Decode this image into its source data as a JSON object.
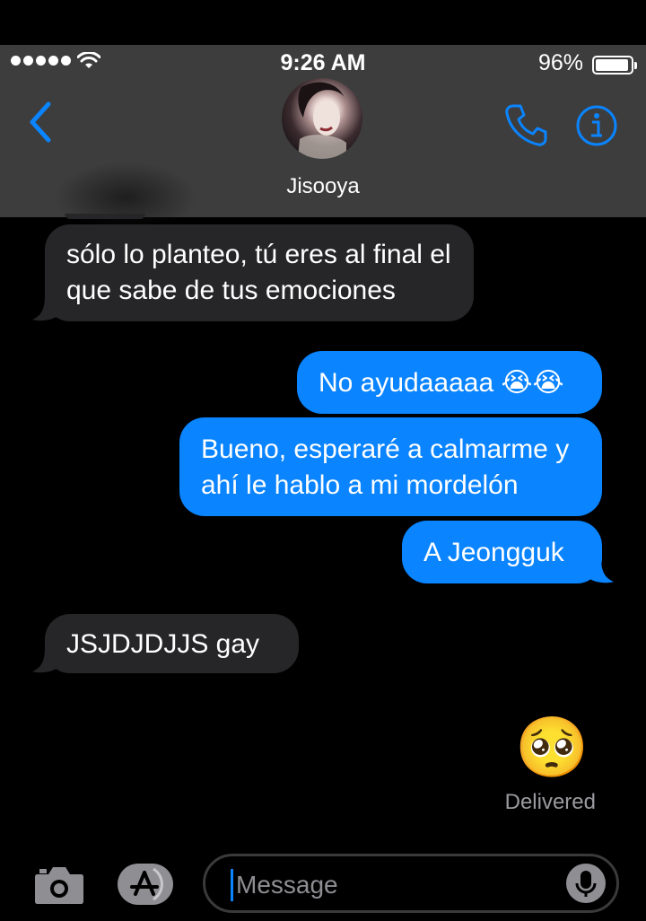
{
  "status_bar": {
    "time": "9:26 AM",
    "battery_percent": "96%",
    "battery_level": 0.96
  },
  "header": {
    "contact_name": "Jisooya",
    "accent_color": "#0a84ff",
    "icons": [
      "chevron-left-icon",
      "phone-icon",
      "info-icon"
    ]
  },
  "messages": [
    {
      "direction": "incoming",
      "text": "sólo lo planteo, tú eres al final el que sabe de tus emociones"
    },
    {
      "direction": "outgoing",
      "text": "No ayudaaaaa 😭😭"
    },
    {
      "direction": "outgoing",
      "text": "Bueno, esperaré a calmarme y ahí le hablo a mi mordelón"
    },
    {
      "direction": "outgoing",
      "text": "A Jeongguk"
    },
    {
      "direction": "incoming",
      "text": "JSJDJDJJS gay"
    },
    {
      "direction": "outgoing",
      "text": "🥺"
    }
  ],
  "delivery_status": "Delivered",
  "composer": {
    "placeholder": "Message",
    "icons": [
      "camera-icon",
      "app-store-icon",
      "microphone-icon"
    ]
  },
  "colors": {
    "outgoing_bubble": "#0a84ff",
    "incoming_bubble": "#262628",
    "background": "#000000",
    "header_background": "#3d3d3d"
  }
}
